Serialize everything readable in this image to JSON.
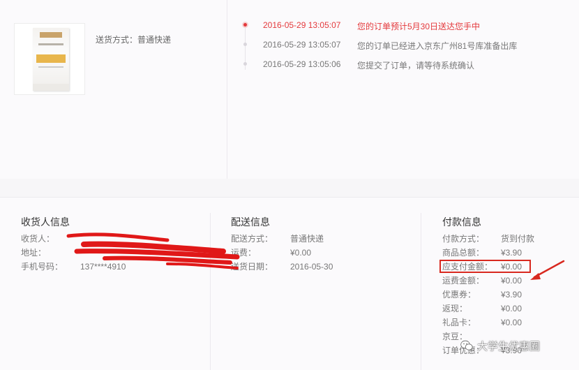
{
  "product": {
    "shipping_label": "送货方式：",
    "shipping_value": "普通快递"
  },
  "timeline": [
    {
      "time": "2016-05-29 13:05:07",
      "text": "您的订单预计5月30日送达您手中",
      "active": true
    },
    {
      "time": "2016-05-29 13:05:07",
      "text": "您的订单已经进入京东广州81号库准备出库",
      "active": false
    },
    {
      "time": "2016-05-29 13:05:06",
      "text": "您提交了订单，请等待系统确认",
      "active": false
    }
  ],
  "receiver": {
    "title": "收货人信息",
    "rows": [
      {
        "label": "收货人：",
        "value": ""
      },
      {
        "label": "地址：",
        "value": ""
      },
      {
        "label": "手机号码：",
        "value": "137****4910"
      }
    ]
  },
  "delivery": {
    "title": "配送信息",
    "rows": [
      {
        "label": "配送方式：",
        "value": "普通快递"
      },
      {
        "label": "运费：",
        "value": "¥0.00"
      },
      {
        "label": "送货日期：",
        "value": "2016-05-30"
      }
    ]
  },
  "payment": {
    "title": "付款信息",
    "rows": [
      {
        "label": "付款方式：",
        "value": "货到付款"
      },
      {
        "label": "商品总额：",
        "value": "¥3.90"
      },
      {
        "label": "应支付金额：",
        "value": "¥0.00"
      },
      {
        "label": "运费金额：",
        "value": "¥0.00"
      },
      {
        "label": "优惠券：",
        "value": "¥3.90"
      },
      {
        "label": "返现：",
        "value": "¥0.00"
      },
      {
        "label": "礼品卡：",
        "value": "¥0.00"
      },
      {
        "label": "京豆：",
        "value": ""
      },
      {
        "label": "订单优惠：",
        "value": "¥3.90"
      }
    ]
  },
  "watermark": {
    "text": "大学生优惠圈",
    "icon": "wechat-icon"
  },
  "colors": {
    "accent": "#e4393c",
    "annotation": "#d8281f"
  }
}
